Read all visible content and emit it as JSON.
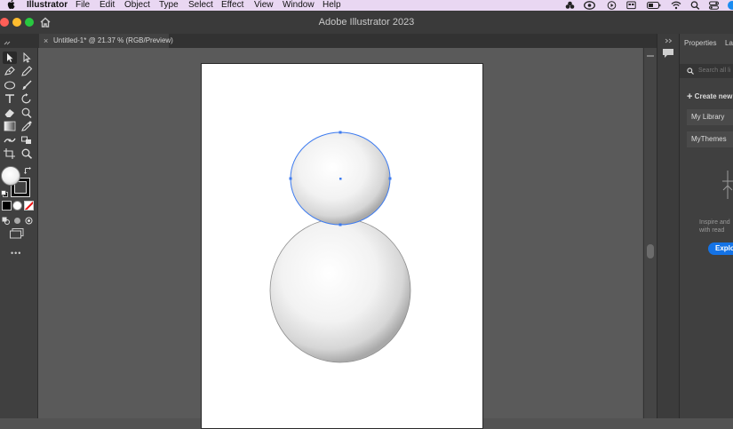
{
  "menubar": {
    "apple_icon": "apple-icon",
    "app_name": "Illustrator",
    "items": [
      "File",
      "Edit",
      "Object",
      "Type",
      "Select",
      "Effect",
      "View",
      "Window",
      "Help"
    ],
    "status_icons": [
      "creative-cloud-icon",
      "cc-libraries-icon",
      "play-icon",
      "display-icon",
      "battery-icon",
      "wifi-icon",
      "search-icon",
      "control-center-icon"
    ]
  },
  "titlebar": {
    "title": "Adobe Illustrator 2023",
    "home_icon": "home-icon",
    "traffic_colors": [
      "#ff5f57",
      "#febc2e",
      "#28c840"
    ]
  },
  "document": {
    "tab_title": "Untitled-1* @ 21.37 % (RGB/Preview)",
    "close_glyph": "×"
  },
  "toolbar": {
    "tools": [
      "selection-tool",
      "direct-selection-tool",
      "pen-tool",
      "pencil-tool",
      "ellipse-tool",
      "paintbrush-tool",
      "type-tool",
      "rotate-tool",
      "eraser-tool",
      "warp-tool",
      "gradient-tool",
      "eyedropper-tool",
      "shape-builder-tool",
      "live-paint-tool",
      "artboard-tool",
      "zoom-tool"
    ],
    "more_glyph": "•••"
  },
  "canvas": {
    "accent": "#3d7bf0",
    "shapes": [
      "small-ellipse-selected",
      "large-ellipse"
    ]
  },
  "right_panel": {
    "tabs": [
      "Properties",
      "Lay"
    ],
    "search_placeholder": "Search all li",
    "create_new_label": "Create new",
    "library_items": [
      "My Library",
      "MyThemes"
    ],
    "hint_lines": [
      "Inspire and",
      "with read"
    ],
    "explore_label": "Explo"
  }
}
